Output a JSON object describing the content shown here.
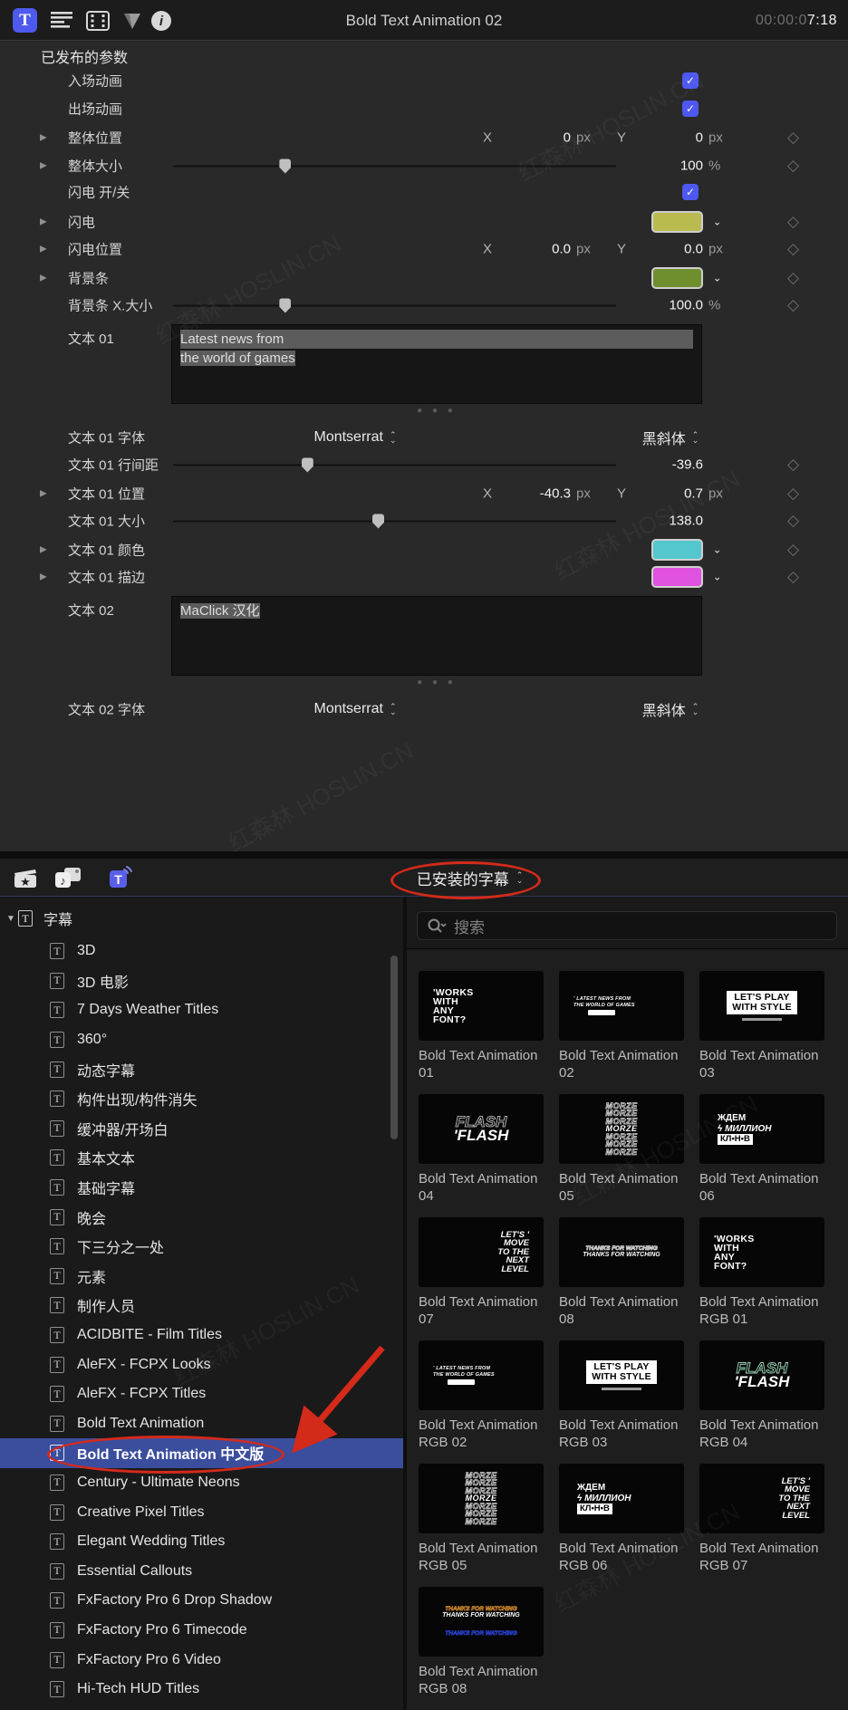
{
  "watermark": "红森林 HOSLIN.CN",
  "inspector": {
    "title": "Bold Text Animation 02",
    "timecode_dim": "00:00:0",
    "timecode_bright": "7:18",
    "section_title": "已发布的参数",
    "xy": {
      "x": "X",
      "y": "Y"
    },
    "rows": {
      "in_anim": {
        "label": "入场动画"
      },
      "out_anim": {
        "label": "出场动画"
      },
      "pos": {
        "label": "整体位置",
        "x": "0",
        "y": "0",
        "unit": "px"
      },
      "size": {
        "label": "整体大小",
        "value": "100",
        "unit": "%"
      },
      "light_sw": {
        "label": "闪电 开/关"
      },
      "light": {
        "label": "闪电",
        "color": "#b9ba50"
      },
      "light_pos": {
        "label": "闪电位置",
        "x": "0.0",
        "y": "0.0",
        "unit": "px"
      },
      "bar": {
        "label": "背景条",
        "color": "#6f8f2f"
      },
      "bar_x": {
        "label": "背景条 X.大小",
        "value": "100.0",
        "unit": "%"
      },
      "text01": {
        "label": "文本 01",
        "line1": "Latest news from",
        "line2": "the world of games"
      },
      "text01_font": {
        "label": "文本 01 字体",
        "font": "Montserrat",
        "face": "黑斜体"
      },
      "text01_leading": {
        "label": "文本 01 行间距",
        "value": "-39.6"
      },
      "text01_pos": {
        "label": "文本 01 位置",
        "x": "-40.3",
        "y": "0.7",
        "unit": "px"
      },
      "text01_size": {
        "label": "文本 01 大小",
        "value": "138.0"
      },
      "text01_color": {
        "label": "文本 01 颜色",
        "color": "#53c7cd"
      },
      "text01_outline": {
        "label": "文本 01 描边",
        "color": "#df52df"
      },
      "text02": {
        "label": "文本 02",
        "line1": "MaClick 汉化"
      },
      "text02_font": {
        "label": "文本 02 字体",
        "font": "Montserrat",
        "face": "黑斜体"
      }
    }
  },
  "browser": {
    "popup_label": "已安装的字幕",
    "search_placeholder": "搜索",
    "sidebar": {
      "root": "字幕",
      "items": [
        "3D",
        "3D 电影",
        "7 Days Weather Titles",
        "360°",
        "动态字幕",
        "构件出现/构件消失",
        "缓冲器/开场白",
        "基本文本",
        "基础字幕",
        "晚会",
        "下三分之一处",
        "元素",
        "制作人员",
        "ACIDBITE - Film Titles",
        "AleFX - FCPX Looks",
        "AleFX - FCPX Titles",
        "Bold Text Animation",
        "Bold Text Animation 中文版",
        "Century - Ultimate Neons",
        "Creative Pixel Titles",
        "Elegant Wedding Titles",
        "Essential Callouts",
        "FxFactory Pro 6 Drop Shadow",
        "FxFactory Pro 6 Timecode",
        "FxFactory Pro 6 Video",
        "Hi-Tech HUD Titles"
      ],
      "selected": "Bold Text Animation 中文版"
    },
    "tiles": [
      {
        "label": "Bold Text Animation 01",
        "lines": [
          "'WORKS",
          "WITH",
          "ANY",
          "FONT?"
        ]
      },
      {
        "label": "Bold Text Animation 02",
        "lines": [
          "' LATEST NEWS FROM",
          "THE WORLD OF GAMES"
        ]
      },
      {
        "label": "Bold Text Animation 03",
        "lines": [
          "LET'S PLAY",
          "WITH STYLE"
        ]
      },
      {
        "label": "Bold Text Animation 04",
        "ghost": "FLASH",
        "lines": [
          "'FLASH"
        ]
      },
      {
        "label": "Bold Text Animation 05",
        "lines": [
          "MORZE",
          "MORZE",
          "MORZE",
          "MORZE",
          "MORZE",
          "MORZE",
          "MORZE"
        ]
      },
      {
        "label": "Bold Text Animation 06",
        "lines": [
          "ЖДЕМ",
          "ϟ МИЛЛИОН",
          "КЛ•Н•В"
        ]
      },
      {
        "label": "Bold Text Animation 07",
        "lines": [
          "LET'S '",
          "MOVE",
          "TO THE",
          "NEXT",
          "LEVEL"
        ]
      },
      {
        "label": "Bold Text Animation 08",
        "ghost": "THANKS FOR WATCHING",
        "lines": [
          "THANKS FOR WATCHING"
        ]
      },
      {
        "label": "Bold Text Animation RGB 01",
        "lines": [
          "'WORKS",
          "WITH",
          "ANY",
          "FONT?"
        ]
      },
      {
        "label": "Bold Text Animation RGB 02",
        "lines": [
          "' LATEST NEWS FROM",
          "THE WORLD OF GAMES"
        ]
      },
      {
        "label": "Bold Text Animation RGB 03",
        "lines": [
          "LET'S PLAY",
          "WITH STYLE"
        ]
      },
      {
        "label": "Bold Text Animation RGB 04",
        "ghost": "FLASH",
        "lines": [
          "'FLASH"
        ]
      },
      {
        "label": "Bold Text Animation RGB 05",
        "lines": [
          "MORZE",
          "MORZE",
          "MORZE",
          "MORZE",
          "MORZE",
          "MORZE",
          "MORZE"
        ]
      },
      {
        "label": "Bold Text Animation RGB 06",
        "lines": [
          "ЖДЕМ",
          "ϟ МИЛЛИОН",
          "КЛ•Н•В"
        ]
      },
      {
        "label": "Bold Text Animation RGB 07",
        "lines": [
          "LET'S '",
          "MOVE",
          "TO THE",
          "NEXT",
          "LEVEL"
        ]
      },
      {
        "label": "Bold Text Animation RGB 08",
        "ghost": "THANKS FOR WATCHING",
        "lines": [
          "THANKS FOR WATCHING"
        ],
        "ghost2": "THANKS FOR WATCHING"
      }
    ]
  }
}
